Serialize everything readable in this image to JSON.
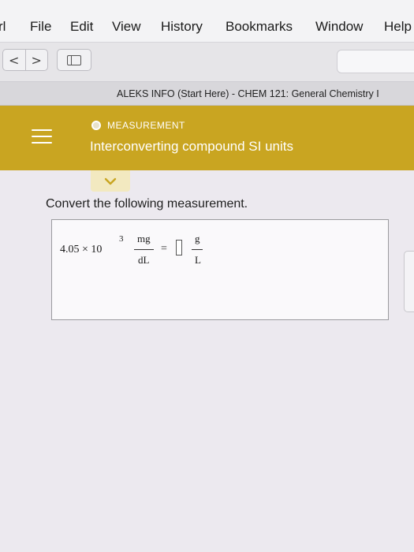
{
  "menubar": {
    "items": [
      "rl",
      "File",
      "Edit",
      "View",
      "History",
      "Bookmarks",
      "Window",
      "Help"
    ]
  },
  "toolbar": {
    "back_glyph": "<",
    "forward_glyph": ">",
    "icons": [
      "chevron-left-icon",
      "chevron-right-icon",
      "sidebar-icon"
    ]
  },
  "tab": {
    "title": "ALEKS INFO (Start Here) - CHEM 121: General Chemistry I"
  },
  "header": {
    "topic_label": "MEASUREMENT",
    "topic_title": "Interconverting compound SI units",
    "color": "#c9a521"
  },
  "problem": {
    "instructions": "Convert the following measurement.",
    "coefficient": "4.05 × 10",
    "exponent": "3",
    "from_numerator": "mg",
    "from_denominator": "dL",
    "equals": "=",
    "to_numerator": "g",
    "to_denominator": "L",
    "answer_value": ""
  }
}
